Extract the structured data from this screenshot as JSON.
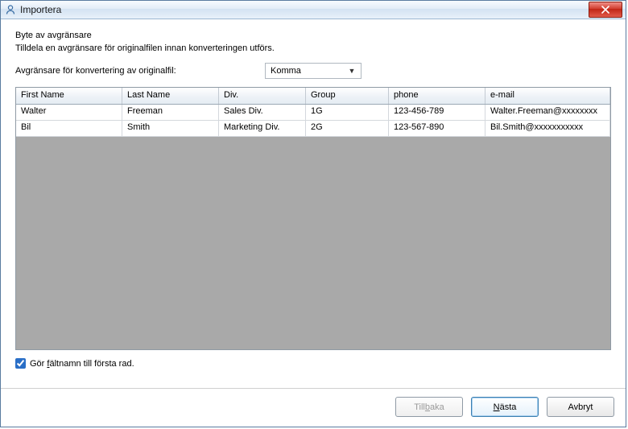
{
  "window": {
    "title": "Importera"
  },
  "content": {
    "heading": "Byte av avgränsare",
    "subheading": "Tilldela en avgränsare för originalfilen innan konverteringen utförs.",
    "delimiter_label": "Avgränsare för konvertering av originalfil:",
    "delimiter_value": "Komma"
  },
  "table": {
    "headers": [
      "First Name",
      "Last Name",
      "Div.",
      "Group",
      "phone",
      "e-mail"
    ],
    "rows": [
      [
        "Walter",
        "Freeman",
        "Sales Div.",
        "1G",
        "123-456-789",
        "Walter.Freeman@xxxxxxxx"
      ],
      [
        "Bil",
        "Smith",
        "Marketing Div.",
        "2G",
        "123-567-890",
        "Bil.Smith@xxxxxxxxxxx"
      ]
    ]
  },
  "checkbox": {
    "label_pre": "Gör ",
    "label_u": "f",
    "label_post": "ältnamn till första rad.",
    "checked": true
  },
  "buttons": {
    "back_pre": "Till",
    "back_u": "b",
    "back_post": "aka",
    "next_u": "N",
    "next_post": "ästa",
    "cancel": "Avbryt"
  }
}
